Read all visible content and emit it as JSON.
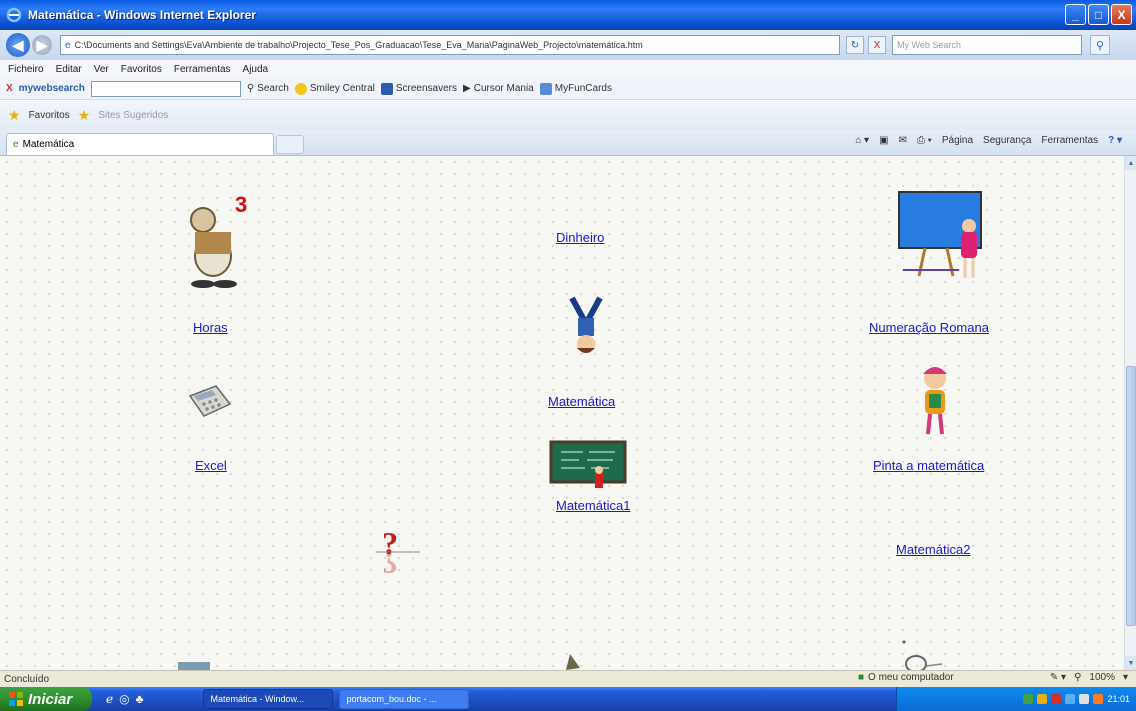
{
  "window": {
    "title": "Matemática - Windows Internet Explorer",
    "minimize": "_",
    "maximize": "□",
    "close": "X"
  },
  "address_bar": {
    "back": "◀",
    "forward": "▶",
    "url": "C:\\Documents and Settings\\Eva\\Ambiente de trabalho\\Projecto_Tese_Pos_Graduacao\\Tese_Eva_Maria\\PaginaWeb_Projecto\\matemática.htm",
    "refresh": "↻",
    "stop": "X",
    "search_placeholder": "My Web Search",
    "search_go": "⚲"
  },
  "menu": [
    "Ficheiro",
    "Editar",
    "Ver",
    "Favoritos",
    "Ferramentas",
    "Ajuda"
  ],
  "toolbar": {
    "close": "X",
    "brand": "mywebsearch",
    "items": [
      "Search",
      "Smiley Central",
      "Screensavers",
      "Cursor Mania",
      "MyFunCards"
    ]
  },
  "favorites_bar": {
    "favorites": "Favoritos",
    "suggested": "Sites Sugeridos"
  },
  "tab": {
    "label": "Matemática"
  },
  "command_bar": [
    "Página",
    "Segurança",
    "Ferramentas"
  ],
  "content": {
    "links": {
      "dinheiro": "Dinheiro",
      "horas": "Horas",
      "numeracao_romana": "Numeração Romana",
      "matematica": "Matemática",
      "excel": "Excel",
      "pinta": "Pinta a matemática",
      "matematica1": "Matemática1",
      "matematica2": "Matemática2"
    },
    "number_icon": "3"
  },
  "status_bar": {
    "text": "Concluído",
    "zone": "O meu computador",
    "zoom": "100%"
  },
  "taskbar": {
    "start": "Iniciar",
    "tasks": [
      "Matemática - Window...",
      "portacom_bou.doc - ..."
    ],
    "clock": "21:01"
  },
  "colors": {
    "link": "#1a1ad0",
    "title_bar": "#0a5ce6",
    "start_button": "#2a8a2a"
  }
}
